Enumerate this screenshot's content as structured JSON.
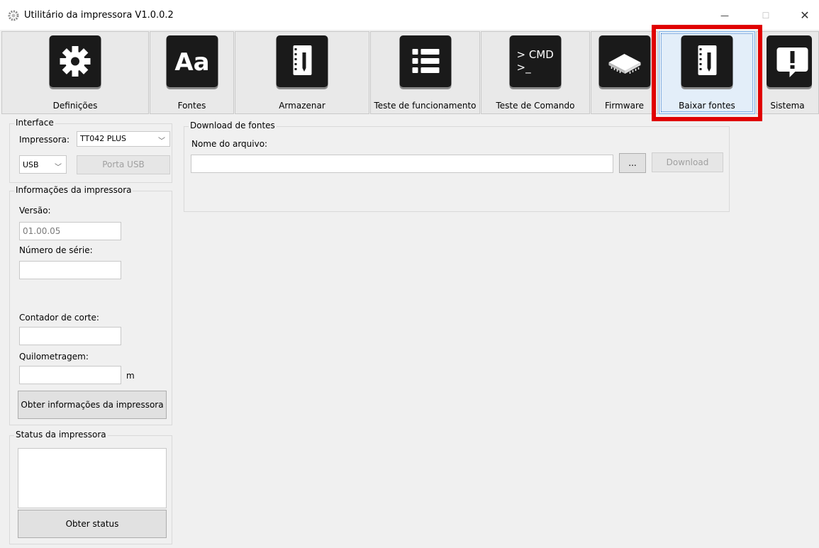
{
  "window": {
    "title": "Utilitário da impressora  V1.0.0.2",
    "minimize": "—",
    "maximize": "☐",
    "close": "✕",
    "icon": "gear-app-icon"
  },
  "toolbar": {
    "buttons": [
      {
        "label": "Definições",
        "icon": "gear-icon"
      },
      {
        "label": "Fontes",
        "icon": "font-aa-icon"
      },
      {
        "label": "Armazenar",
        "icon": "notebook-icon"
      },
      {
        "label": "Teste de funcionamento",
        "icon": "list-icon"
      },
      {
        "label": "Teste de Comando",
        "icon": "cmd-icon",
        "icon_text": "> CMD",
        "icon_text2": ">_"
      },
      {
        "label": "Firmware",
        "icon": "chip-icon"
      },
      {
        "label": "Baixar fontes",
        "icon": "notebook-icon",
        "selected": true
      },
      {
        "label": "Sistema",
        "icon": "exclamation-icon"
      }
    ]
  },
  "interface": {
    "title": "Interface",
    "printer_label": "Impressora:",
    "printer_value": "TT042 PLUS",
    "port_value": "USB",
    "port_button": "Porta USB"
  },
  "printer_info": {
    "title": "Informações da impressora",
    "version_label": "Versão:",
    "version_value": "01.00.05",
    "serial_label": "Número de série:",
    "serial_value": "",
    "cut_counter_label": "Contador de corte:",
    "cut_counter_value": "",
    "mileage_label": "Quilometragem:",
    "mileage_value": "",
    "mileage_unit": "m",
    "get_info_button": "Obter informações da impressora"
  },
  "printer_status": {
    "title": "Status da impressora",
    "status_text": "",
    "get_status_button": "Obter status"
  },
  "download_fonts": {
    "title": "Download de fontes",
    "filename_label": "Nome do arquivo:",
    "filename_value": "",
    "browse_button": "...",
    "download_button": "Download"
  },
  "colors": {
    "highlight": "#e00000",
    "icon_bg": "#1a1a1a",
    "selected_border": "#7eb4ea"
  }
}
